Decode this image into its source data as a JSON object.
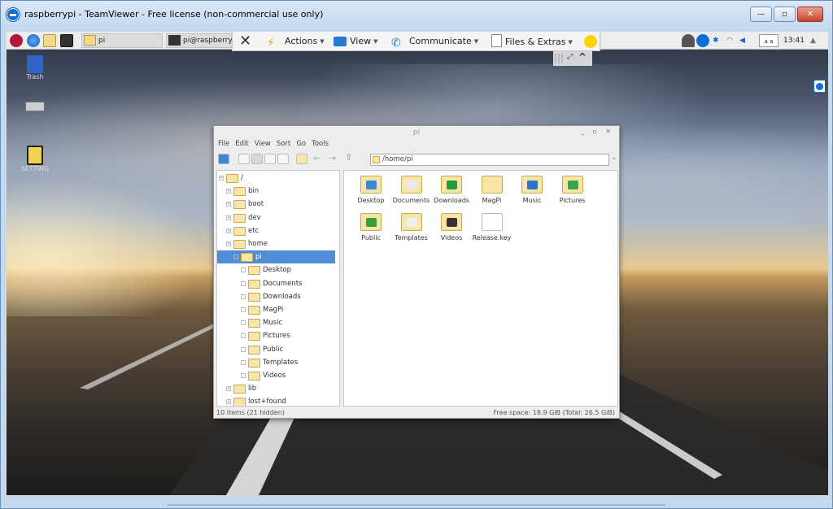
{
  "window": {
    "title": "raspberrypi - TeamViewer - Free license (non-commercial use only)",
    "minimize_label": "—",
    "maximize_label": "▫",
    "close_label": "✕"
  },
  "taskbar": {
    "tasks": [
      {
        "label": "pi"
      },
      {
        "label": "pi@raspberrypi:"
      }
    ],
    "clock": "13:41",
    "kb_layout": "a a"
  },
  "tv_toolbar": {
    "actions_label": "Actions",
    "view_label": "View",
    "communicate_label": "Communicate",
    "files_label": "Files & Extras"
  },
  "desktop": {
    "icons": [
      {
        "label": "Trash"
      },
      {
        "label": ""
      },
      {
        "label": "SETTING"
      }
    ]
  },
  "file_manager": {
    "title": "pi",
    "menu": [
      "File",
      "Edit",
      "View",
      "Sort",
      "Go",
      "Tools"
    ],
    "address": "/home/pi",
    "tree": [
      {
        "label": "/",
        "depth": 0
      },
      {
        "label": "bin",
        "depth": 1
      },
      {
        "label": "boot",
        "depth": 1
      },
      {
        "label": "dev",
        "depth": 1
      },
      {
        "label": "etc",
        "depth": 1
      },
      {
        "label": "home",
        "depth": 1
      },
      {
        "label": "pi",
        "depth": 2,
        "selected": true
      },
      {
        "label": "Desktop",
        "depth": 3
      },
      {
        "label": "Documents",
        "depth": 3
      },
      {
        "label": "Downloads",
        "depth": 3
      },
      {
        "label": "MagPi",
        "depth": 3
      },
      {
        "label": "Music",
        "depth": 3
      },
      {
        "label": "Pictures",
        "depth": 3
      },
      {
        "label": "Public",
        "depth": 3
      },
      {
        "label": "Templates",
        "depth": 3
      },
      {
        "label": "Videos",
        "depth": 3
      },
      {
        "label": "lib",
        "depth": 1
      },
      {
        "label": "lost+found",
        "depth": 1
      }
    ],
    "files": [
      {
        "label": "Desktop",
        "icon": "desktop-icon",
        "color": "#3a88d6"
      },
      {
        "label": "Documents",
        "icon": "documents-icon",
        "color": "#eaeaea"
      },
      {
        "label": "Downloads",
        "icon": "downloads-icon",
        "color": "#1e9e3a"
      },
      {
        "label": "MagPi",
        "icon": "folder-icon",
        "color": ""
      },
      {
        "label": "Music",
        "icon": "music-icon",
        "color": "#2f73c6"
      },
      {
        "label": "Pictures",
        "icon": "pictures-icon",
        "color": "#3ca34a"
      },
      {
        "label": "Public",
        "icon": "public-icon",
        "color": "#3a9e3a"
      },
      {
        "label": "Templates",
        "icon": "templates-icon",
        "color": "#f0f0f0"
      },
      {
        "label": "Videos",
        "icon": "videos-icon",
        "color": "#333333"
      },
      {
        "label": "Release.key",
        "icon": "file-icon",
        "color": "#ffffff"
      }
    ],
    "status_left": "10 items (21 hidden)",
    "status_right": "Free space: 18.9 GiB (Total: 26.5 GiB)"
  }
}
